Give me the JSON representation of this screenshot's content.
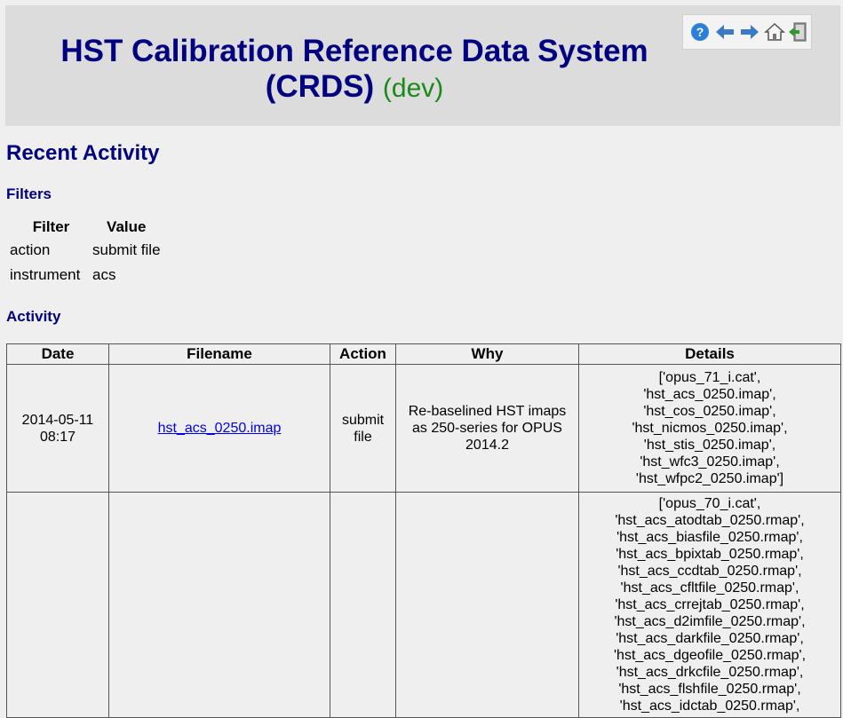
{
  "header": {
    "title": "HST Calibration Reference Data System",
    "title_line2": "(CRDS)",
    "env": "(dev)",
    "icons": [
      "help-icon",
      "back-arrow-icon",
      "forward-arrow-icon",
      "home-icon",
      "logout-icon"
    ]
  },
  "page": {
    "heading": "Recent Activity"
  },
  "filters": {
    "heading": "Filters",
    "col_filter": "Filter",
    "col_value": "Value",
    "rows": [
      {
        "filter": "action",
        "value": "submit file"
      },
      {
        "filter": "instrument",
        "value": "acs"
      }
    ]
  },
  "activity": {
    "heading": "Activity",
    "columns": [
      "Date",
      "Filename",
      "Action",
      "Why",
      "Details"
    ],
    "rows": [
      {
        "date": "2014-05-11 08:17",
        "filename": "hst_acs_0250.imap",
        "action": "submit file",
        "why": "Re-baselined HST imaps as 250-series for OPUS 2014.2",
        "details": [
          "['opus_71_i.cat',",
          "'hst_acs_0250.imap',",
          "'hst_cos_0250.imap',",
          "'hst_nicmos_0250.imap',",
          "'hst_stis_0250.imap',",
          "'hst_wfc3_0250.imap',",
          "'hst_wfpc2_0250.imap']"
        ]
      },
      {
        "date": "",
        "filename": "",
        "action": "",
        "why": "",
        "details": [
          "['opus_70_i.cat',",
          "'hst_acs_atodtab_0250.rmap',",
          "'hst_acs_biasfile_0250.rmap',",
          "'hst_acs_bpixtab_0250.rmap',",
          "'hst_acs_ccdtab_0250.rmap',",
          "'hst_acs_cfltfile_0250.rmap',",
          "'hst_acs_crrejtab_0250.rmap',",
          "'hst_acs_d2imfile_0250.rmap',",
          "'hst_acs_darkfile_0250.rmap',",
          "'hst_acs_dgeofile_0250.rmap',",
          "'hst_acs_drkcfile_0250.rmap',",
          "'hst_acs_flshfile_0250.rmap',",
          "'hst_acs_idctab_0250.rmap',"
        ]
      }
    ]
  }
}
